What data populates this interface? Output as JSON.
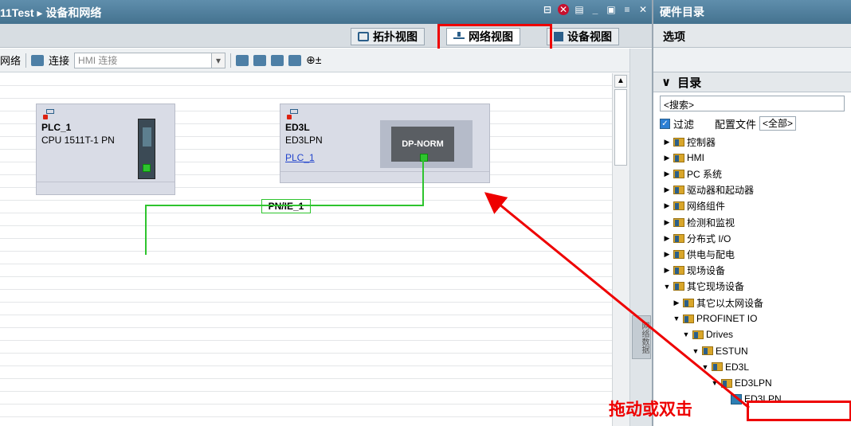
{
  "window": {
    "title": "11Test ▸ 设备和网络"
  },
  "view_tabs": [
    {
      "label": "拓扑视图",
      "icon": "topology-icon",
      "active": false
    },
    {
      "label": "网络视图",
      "icon": "network-icon",
      "active": true
    },
    {
      "label": "设备视图",
      "icon": "device-icon",
      "active": false
    }
  ],
  "toolbar": {
    "network_label": "网络",
    "connect_label": "连接",
    "connection_type": "HMI 连接"
  },
  "devices": {
    "plc": {
      "name": "PLC_1",
      "type": "CPU 1511T-1 PN"
    },
    "ed3l": {
      "name": "ED3L",
      "type": "ED3LPN",
      "controller_link": "PLC_1",
      "module_label": "DP-NORM"
    }
  },
  "network": {
    "label": "PN/IE_1",
    "color": "#2ec42e"
  },
  "side_strip": {
    "label": "网络数据"
  },
  "catalog": {
    "title": "硬件目录",
    "options_label": "选项",
    "section_title": "目录",
    "search_placeholder": "<搜索>",
    "filter_label": "过滤",
    "profile_label": "配置文件",
    "profile_value": "<全部>",
    "tree": [
      {
        "label": "控制器",
        "expanded": false
      },
      {
        "label": "HMI",
        "expanded": false
      },
      {
        "label": "PC 系统",
        "expanded": false
      },
      {
        "label": "驱动器和起动器",
        "expanded": false
      },
      {
        "label": "网络组件",
        "expanded": false
      },
      {
        "label": "检测和监视",
        "expanded": false
      },
      {
        "label": "分布式 I/O",
        "expanded": false
      },
      {
        "label": "供电与配电",
        "expanded": false
      },
      {
        "label": "现场设备",
        "expanded": false
      },
      {
        "label": "其它现场设备",
        "expanded": true
      },
      {
        "label": "其它以太网设备",
        "expanded": false
      },
      {
        "label": "PROFINET IO",
        "expanded": true
      },
      {
        "label": "Drives",
        "expanded": true
      },
      {
        "label": "ESTUN",
        "expanded": true
      },
      {
        "label": "ED3L",
        "expanded": true
      },
      {
        "label": "ED3LPN",
        "expanded": true
      },
      {
        "label": "ED3LPN",
        "leaf": true
      }
    ]
  },
  "annotation": {
    "text": "拖动或双击",
    "color": "#e00000"
  }
}
